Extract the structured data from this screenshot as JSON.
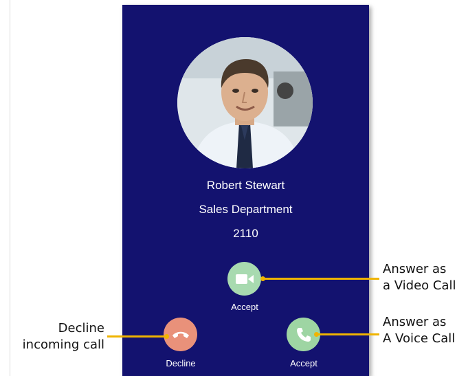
{
  "caller": {
    "name": "Robert Stewart",
    "department": "Sales Department",
    "extension": "2110"
  },
  "actions": {
    "video_accept_label": "Accept",
    "decline_label": "Decline",
    "voice_accept_label": "Accept"
  },
  "annotations": {
    "video": {
      "line1": "Answer as",
      "line2": "a Video Call"
    },
    "voice": {
      "line1": "Answer as",
      "line2": "A Voice Call"
    },
    "decline": {
      "line1": "Decline",
      "line2": "incoming call"
    }
  },
  "icons": {
    "avatar": "caller-photo",
    "video": "video-camera-icon",
    "decline": "phone-hangup-icon",
    "voice": "phone-icon"
  },
  "colors": {
    "screen_background": "#13126f",
    "accept_button": "#a8dab0",
    "decline_button": "#e9917a",
    "callout_line": "#f0b400",
    "text": "#ffffff"
  }
}
